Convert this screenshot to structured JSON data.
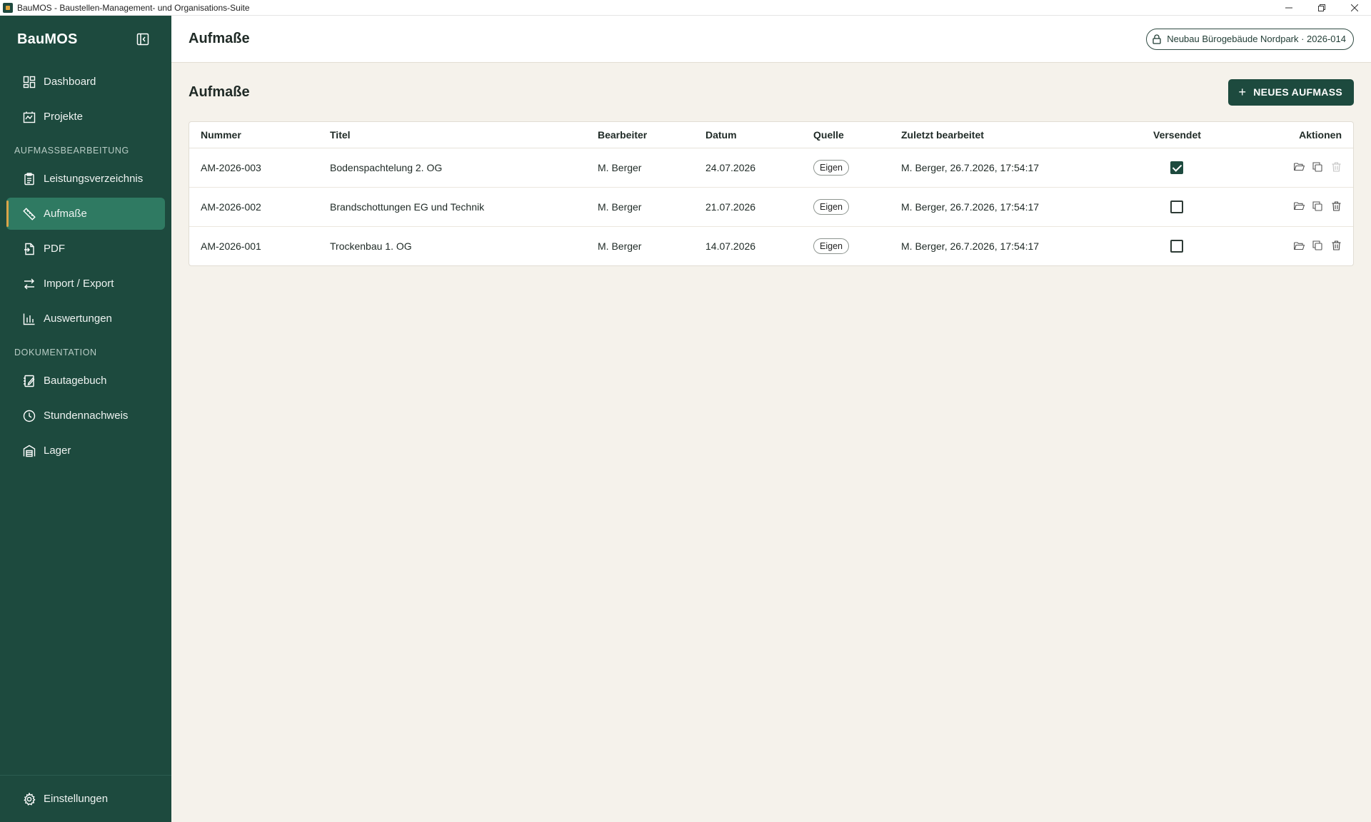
{
  "window": {
    "title": "BauMOS - Baustellen-Management- und Organisations-Suite",
    "controls": [
      "minimize-icon",
      "restore-icon",
      "close-icon"
    ]
  },
  "sidebar": {
    "brand": "BauMOS",
    "items_top": [
      {
        "label": "Dashboard",
        "icon": "dashboard-icon"
      },
      {
        "label": "Projekte",
        "icon": "projects-icon"
      }
    ],
    "section_1": "AUFMASSBEARBEITUNG",
    "items_aufmass": [
      {
        "label": "Leistungsverzeichnis",
        "icon": "clipboard-icon"
      },
      {
        "label": "Aufmaße",
        "icon": "ruler-icon",
        "active": true
      },
      {
        "label": "PDF",
        "icon": "pdf-icon"
      },
      {
        "label": "Import / Export",
        "icon": "swap-icon"
      },
      {
        "label": "Auswertungen",
        "icon": "bar-chart-icon"
      }
    ],
    "section_2": "DOKUMENTATION",
    "items_doku": [
      {
        "label": "Bautagebuch",
        "icon": "diary-icon"
      },
      {
        "label": "Stundennachweis",
        "icon": "clock-icon"
      },
      {
        "label": "Lager",
        "icon": "warehouse-icon"
      }
    ],
    "footer_item": {
      "label": "Einstellungen",
      "icon": "gear-icon"
    }
  },
  "header": {
    "title": "Aufmaße",
    "project": "Neubau Bürogebäude Nordpark · 2026-014"
  },
  "main": {
    "title": "Aufmaße",
    "new_button": "NEUES AUFMASS",
    "table": {
      "columns": [
        "Nummer",
        "Titel",
        "Bearbeiter",
        "Datum",
        "Quelle",
        "Zuletzt bearbeitet",
        "Versendet",
        "Aktionen"
      ],
      "rows": [
        {
          "nummer": "AM-2026-003",
          "titel": "Bodenspachtelung 2. OG",
          "bearbeiter": "M. Berger",
          "datum": "24.07.2026",
          "quelle": "Eigen",
          "zuletzt": "M. Berger, 26.7.2026, 17:54:17",
          "versendet": true
        },
        {
          "nummer": "AM-2026-002",
          "titel": "Brandschottungen EG und Technik",
          "bearbeiter": "M. Berger",
          "datum": "21.07.2026",
          "quelle": "Eigen",
          "zuletzt": "M. Berger, 26.7.2026, 17:54:17",
          "versendet": false
        },
        {
          "nummer": "AM-2026-001",
          "titel": "Trockenbau 1. OG",
          "bearbeiter": "M. Berger",
          "datum": "14.07.2026",
          "quelle": "Eigen",
          "zuletzt": "M. Berger, 26.7.2026, 17:54:17",
          "versendet": false
        }
      ]
    }
  },
  "colors": {
    "sidebar": "#1d4a3e",
    "active": "#2f7a62",
    "accent": "#d9a449",
    "background": "#f5f2eb"
  }
}
